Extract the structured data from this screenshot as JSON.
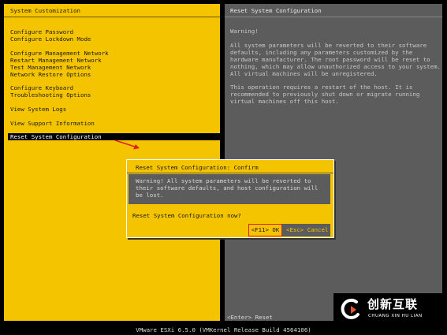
{
  "left_pane": {
    "title": "System Customization",
    "items": [
      {
        "label": "Configure Password"
      },
      {
        "label": "Configure Lockdown Mode"
      },
      {
        "label": "Configure Management Network"
      },
      {
        "label": "Restart Management Network"
      },
      {
        "label": "Test Management Network"
      },
      {
        "label": "Network Restore Options"
      },
      {
        "label": "Configure Keyboard"
      },
      {
        "label": "Troubleshooting Options"
      },
      {
        "label": "View System Logs"
      },
      {
        "label": "View Support Information"
      },
      {
        "label": "Reset System Configuration",
        "selected": true
      }
    ]
  },
  "right_pane": {
    "title": "Reset System Configuration",
    "warning_heading": "Warning!",
    "paragraph1": "All system parameters will be reverted to their software\ndefaults, including any parameters customized by the\nhardware manufacturer. The root password will be reset to\nnothing, which may allow unauthorized access to your system.\nAll virtual machines will be unregistered.",
    "paragraph2": "This operation requires a restart of the host. It is\nrecommended to previously shut down or migrate running\nvirtual machines off this host.",
    "footer_hint": "<Enter> Reset"
  },
  "dialog": {
    "title": "Reset System Configuration: Confirm",
    "body": "Warning! All system parameters will be reverted to\ntheir software defaults, and host configuration will\nbe lost.",
    "question": "Reset System Configuration now?",
    "ok_label": "<F11> OK",
    "cancel_label": "<Esc> Cancel"
  },
  "status_bar": {
    "text": "VMware ESXi 6.5.0 (VMKernel Release Build 4564106)"
  },
  "watermark": {
    "main": "创新互联",
    "sub": "CHUANG XIN HU LIAN"
  },
  "colors": {
    "accent_yellow": "#f5c400",
    "pane_gray": "#5c5c5c",
    "highlight_red": "#e02020",
    "background": "#000000"
  }
}
